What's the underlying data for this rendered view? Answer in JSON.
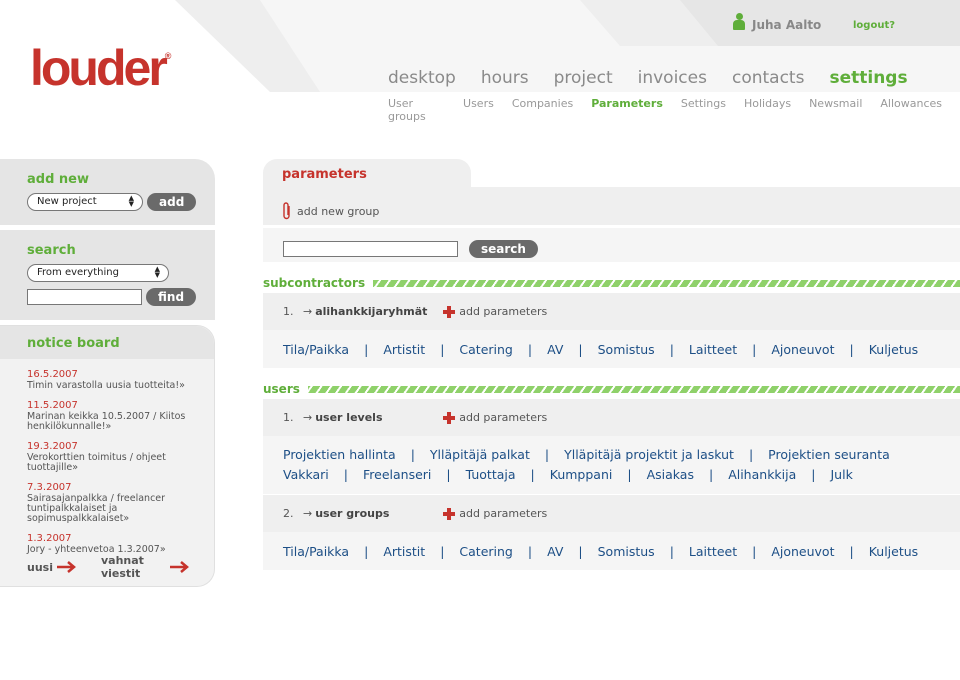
{
  "header": {
    "logo": "louder",
    "logo_registered": "®",
    "user": "Juha Aalto",
    "logout": "logout?"
  },
  "main_nav": [
    {
      "label": "desktop",
      "active": false
    },
    {
      "label": "hours",
      "active": false
    },
    {
      "label": "project",
      "active": false
    },
    {
      "label": "invoices",
      "active": false
    },
    {
      "label": "contacts",
      "active": false
    },
    {
      "label": "settings",
      "active": true
    }
  ],
  "sub_nav": [
    {
      "label": "User groups",
      "active": false
    },
    {
      "label": "Users",
      "active": false
    },
    {
      "label": "Companies",
      "active": false
    },
    {
      "label": "Parameters",
      "active": true
    },
    {
      "label": "Settings",
      "active": false
    },
    {
      "label": "Holidays",
      "active": false
    },
    {
      "label": "Newsmail",
      "active": false
    },
    {
      "label": "Allowances",
      "active": false
    }
  ],
  "sidebar": {
    "add_new": {
      "title": "add new",
      "select_value": "New project",
      "button": "add"
    },
    "search": {
      "title": "search",
      "select_value": "From everything",
      "button": "find"
    },
    "notice_board": {
      "title": "notice board",
      "items": [
        {
          "date": "16.5.2007",
          "text": "Timin varastolla uusia tuotteita!»"
        },
        {
          "date": "11.5.2007",
          "text": "Marinan keikka 10.5.2007 / Kiitos henkilökunnalle!»"
        },
        {
          "date": "19.3.2007",
          "text": "Verokorttien toimitus / ohjeet tuottajille»"
        },
        {
          "date": "7.3.2007",
          "text": "Sairasajanpalkka / freelancer tuntipalkkalaiset ja sopimuspalkkalaiset»"
        },
        {
          "date": "1.3.2007",
          "text": "Jory - yhteenvetoa 1.3.2007»"
        }
      ],
      "new_label": "uusi",
      "old_label": "vahnat viestit"
    }
  },
  "main": {
    "tab_title": "parameters",
    "add_group": "add new group",
    "search_button": "search",
    "add_parameters": "add parameters",
    "sections": [
      {
        "title": "subcontractors",
        "groups": [
          {
            "num": "1.",
            "name": "alihankkijaryhmät",
            "lines": [
              [
                "Tila/Paikka",
                "Artistit",
                "Catering",
                "AV",
                "Somistus",
                "Laitteet",
                "Ajoneuvot",
                "Kuljetus"
              ]
            ]
          }
        ]
      },
      {
        "title": "users",
        "groups": [
          {
            "num": "1.",
            "name": "user levels",
            "lines": [
              [
                "Projektien hallinta",
                "Ylläpitäjä palkat",
                "Ylläpitäjä projektit ja laskut",
                "Projektien seuranta"
              ],
              [
                "Vakkari",
                "Freelanseri",
                "Tuottaja",
                "Kumppani",
                "Asiakas",
                "Alihankkija",
                "Julk"
              ]
            ]
          },
          {
            "num": "2.",
            "name": "user groups",
            "lines": [
              [
                "Tila/Paikka",
                "Artistit",
                "Catering",
                "AV",
                "Somistus",
                "Laitteet",
                "Ajoneuvot",
                "Kuljetus"
              ]
            ]
          }
        ]
      }
    ]
  }
}
